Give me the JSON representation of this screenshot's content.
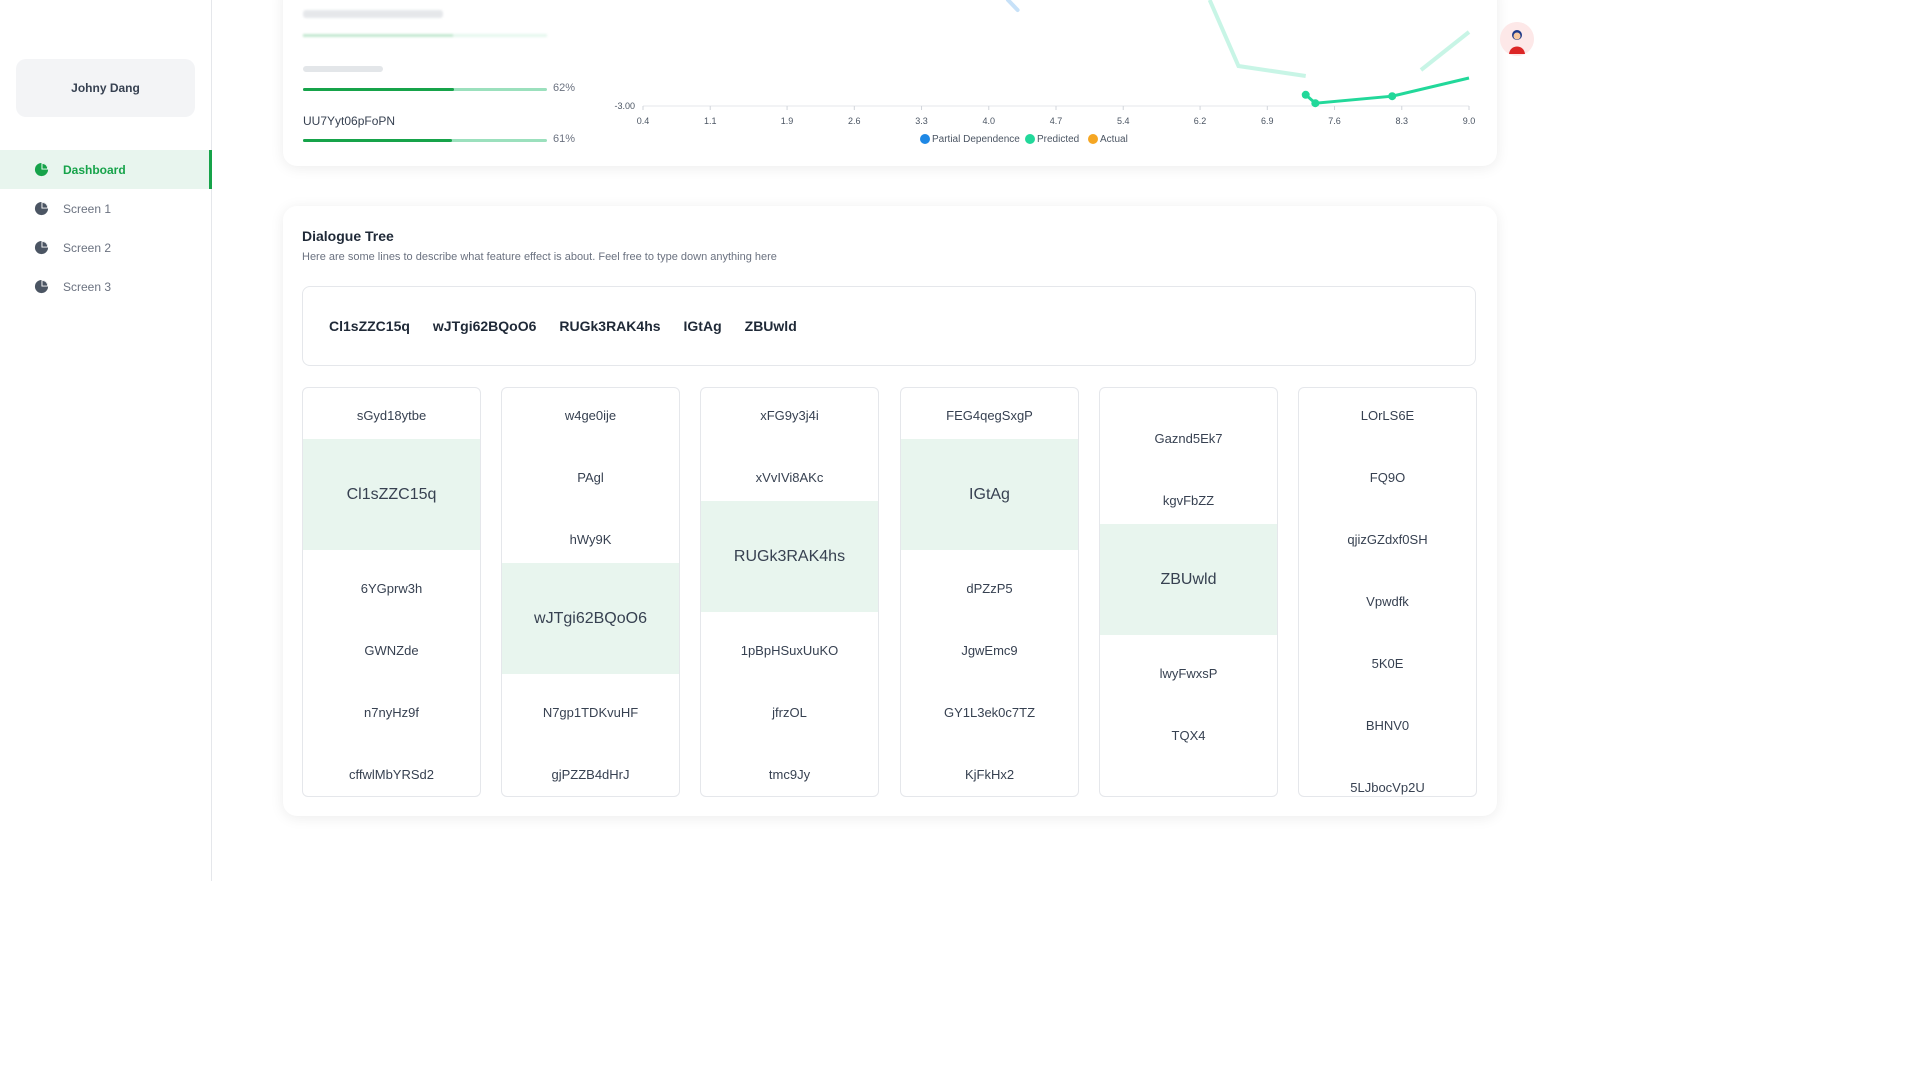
{
  "user": {
    "name": "Johny Dang"
  },
  "nav": [
    {
      "label": "Dashboard",
      "active": true
    },
    {
      "label": "Screen 1"
    },
    {
      "label": "Screen 2"
    },
    {
      "label": "Screen 3"
    }
  ],
  "feature_list": [
    {
      "name": "UU7Yyt06pFoPN",
      "pct": "61%",
      "value": 0.61
    },
    {
      "name": "",
      "pct": "62%",
      "value": 0.62
    }
  ],
  "chart_data": {
    "type": "line",
    "x_ticks": [
      "0.4",
      "1.1",
      "1.9",
      "2.6",
      "3.3",
      "4.0",
      "4.7",
      "5.4",
      "6.2",
      "6.9",
      "7.6",
      "8.3",
      "9.0"
    ],
    "y_ticks": [
      "-3.00"
    ],
    "legend": [
      "Partial Dependence",
      "Predicted",
      "Actual"
    ],
    "legend_colors": [
      "#1e88e5",
      "#22d89a",
      "#f5a623"
    ],
    "legend_position": "bottom",
    "series": [
      {
        "name": "Predicted",
        "x": [
          7.3,
          7.4,
          8.2,
          9.0
        ],
        "y": [
          -2.6,
          -2.9,
          -2.65,
          -2.0
        ]
      }
    ]
  },
  "dialogue": {
    "title": "Dialogue Tree",
    "subtitle": "Here are some lines to describe what feature effect is about. Feel free to type down anything here",
    "path": [
      "Cl1sZZC15q",
      "wJTgi62BQoO6",
      "RUGk3RAK4hs",
      "IGtAg",
      "ZBUwld"
    ],
    "columns": [
      {
        "items": [
          "sGyd18ytbe",
          "Cl1sZZC15q",
          "6YGprw3h",
          "GWNZde",
          "n7nyHz9f",
          "cffwlMbYRSd2"
        ],
        "selected": 1
      },
      {
        "items": [
          "w4ge0ije",
          "PAgl",
          "hWy9K",
          "wJTgi62BQoO6",
          "N7gp1TDKvuHF",
          "gjPZZB4dHrJ"
        ],
        "selected": 3
      },
      {
        "items": [
          "xFG9y3j4i",
          "xVvIVi8AKc",
          "RUGk3RAK4hs",
          "1pBpHSuxUuKO",
          "jfrzOL",
          "tmc9Jy"
        ],
        "selected": 2
      },
      {
        "items": [
          "FEG4qegSxgP",
          "IGtAg",
          "dPZzP5",
          "JgwEmc9",
          "GY1L3ek0c7TZ",
          "KjFkHx2"
        ],
        "selected": 1
      },
      {
        "items": [
          "Gaznd5Ek7",
          "kgvFbZZ",
          "ZBUwld",
          "lwyFwxsP",
          "TQX4"
        ],
        "selected": 2
      },
      {
        "items": [
          "LOrLS6E",
          "FQ9O",
          "qjizGZdxf0SH",
          "Vpwdfk",
          "5K0E",
          "BHNV0",
          "5LJbocVp2U"
        ],
        "selected": -1
      }
    ]
  }
}
